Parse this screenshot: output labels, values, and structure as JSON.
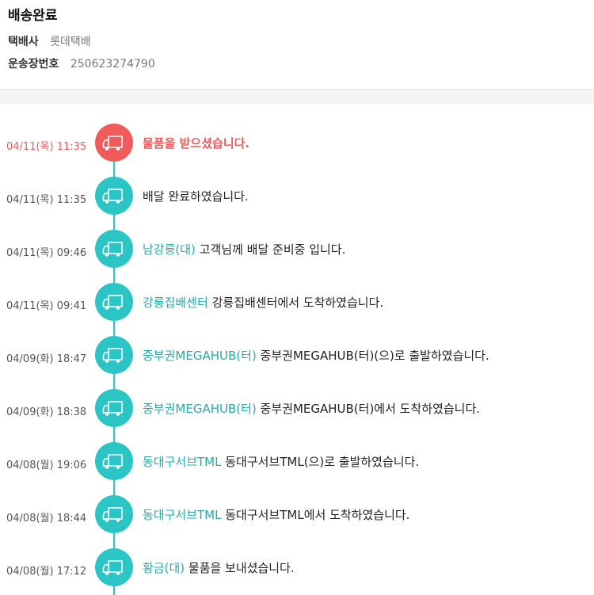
{
  "header": {
    "title": "배송완료",
    "carrier_label": "택배사",
    "carrier_value": "롯데택배",
    "tracking_label": "운송장번호",
    "tracking_value": "250623274790"
  },
  "colors": {
    "accent_teal": "#2cc5c6",
    "current_red": "#f15b5b",
    "location_text": "#27a9aa"
  },
  "events": [
    {
      "time": "04/11(목) 11:35",
      "location": "",
      "message": "물품을 받으셨습니다.",
      "current": true
    },
    {
      "time": "04/11(목) 11:35",
      "location": "",
      "message": "배달 완료하였습니다."
    },
    {
      "time": "04/11(목) 09:46",
      "location": "남강릉(대)",
      "message": "고객님께 배달 준비중 입니다."
    },
    {
      "time": "04/11(목) 09:41",
      "location": "강릉집배센터",
      "message": "강릉집배센터에서 도착하였습니다."
    },
    {
      "time": "04/09(화) 18:47",
      "location": "중부권MEGAHUB(터)",
      "message": "중부권MEGAHUB(터)(으)로 출발하였습니다."
    },
    {
      "time": "04/09(화) 18:38",
      "location": "중부권MEGAHUB(터)",
      "message": "중부권MEGAHUB(터)에서 도착하였습니다."
    },
    {
      "time": "04/08(월) 19:06",
      "location": "동대구서브TML",
      "message": "동대구서브TML(으)로 출발하였습니다."
    },
    {
      "time": "04/08(월) 18:44",
      "location": "동대구서브TML",
      "message": "동대구서브TML에서 도착하였습니다."
    },
    {
      "time": "04/08(월) 17:12",
      "location": "황금(대)",
      "message": "물품을 보내셨습니다."
    }
  ],
  "icon": "truck-icon"
}
